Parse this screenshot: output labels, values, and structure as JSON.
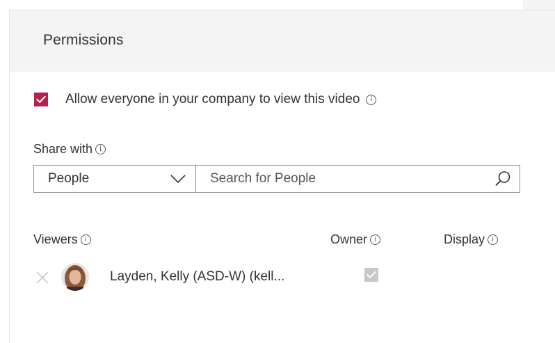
{
  "panel": {
    "title": "Permissions"
  },
  "allow_everyone": {
    "label": "Allow everyone in your company to view this video",
    "checked": true,
    "info_icon": "info-icon"
  },
  "share_with": {
    "label": "Share with",
    "info_icon": "info-icon",
    "select_value": "People",
    "select_icon": "chevron-down-icon",
    "search_placeholder": "Search for People",
    "search_icon": "search-icon"
  },
  "viewers_table": {
    "columns": {
      "viewers": "Viewers",
      "owner": "Owner",
      "display": "Display"
    },
    "rows": [
      {
        "name": "Layden, Kelly (ASD-W) (kell...",
        "owner_checked": true,
        "owner_disabled": true,
        "remove_icon": "close-icon",
        "avatar": "avatar"
      }
    ]
  },
  "colors": {
    "accent": "#b4214a",
    "header_bg": "#f4f4f4",
    "border": "#8a8a8a",
    "disabled_check": "#c8c8c8",
    "text": "#333333"
  }
}
